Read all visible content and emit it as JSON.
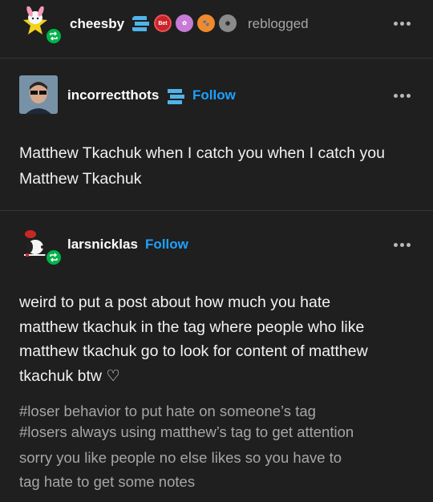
{
  "reblogger": {
    "username": "cheesby",
    "action": "reblogged",
    "badges": [
      "checkmark-badge",
      "bet-badge",
      "flower-badge",
      "paw-badge",
      "cat-badge"
    ],
    "accent": "#00b34a"
  },
  "post1": {
    "username": "incorrectthots",
    "follow_label": "Follow",
    "text_lines": [
      "Matthew Tkachuk when I catch you when I catch you",
      "Matthew Tkachuk"
    ]
  },
  "post2": {
    "username": "larsnicklas",
    "follow_label": "Follow",
    "text_lines": [
      "weird to put a post about how much you hate",
      "matthew tkachuk in the tag where people who like",
      "matthew tkachuk go to look for content of matthew",
      "tkachuk btw ♡"
    ],
    "tags": [
      "#loser behavior to put hate on someone’s tag",
      "#losers always using matthew’s tag to get attention",
      "sorry you like people no else likes so you have to",
      "tag hate to get some notes"
    ]
  },
  "colors": {
    "background": "#1f1f1f",
    "link": "#1ea0ff",
    "muted": "#a6a6a6"
  }
}
